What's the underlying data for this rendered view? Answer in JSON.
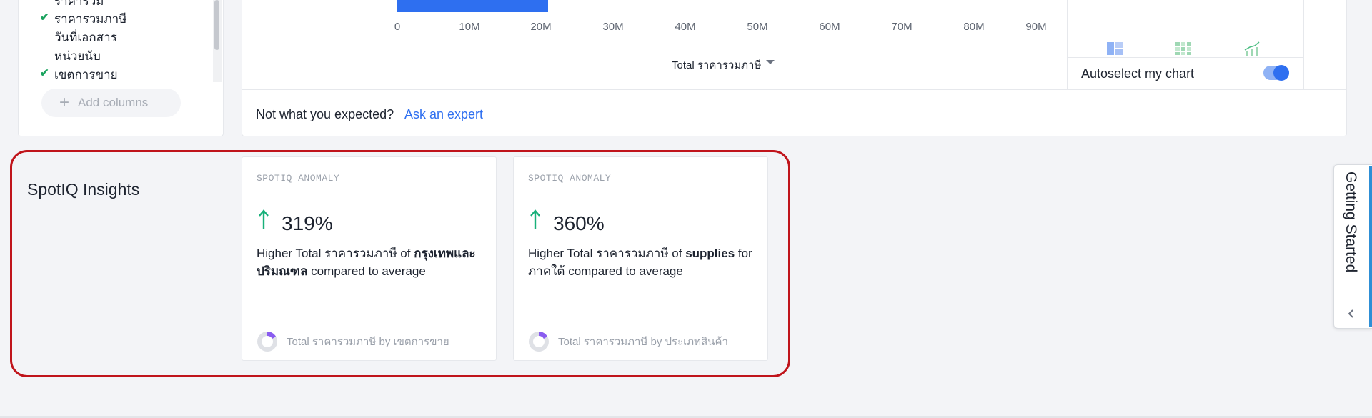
{
  "columns_panel": {
    "items": [
      {
        "label": "ราคารวม",
        "checked": false
      },
      {
        "label": "ราคารวมภาษี",
        "checked": true
      },
      {
        "label": "วันที่เอกสาร",
        "checked": false
      },
      {
        "label": "หน่วยนับ",
        "checked": false
      },
      {
        "label": "เขตการขาย",
        "checked": true
      }
    ],
    "add_columns_label": "Add columns"
  },
  "chart": {
    "axis_ticks": [
      "0",
      "10M",
      "20M",
      "30M",
      "40M",
      "50M",
      "60M",
      "70M",
      "80M",
      "90M"
    ],
    "axis_label": "Total ราคารวมภาษี",
    "autoselect_label": "Autoselect my chart",
    "autoselect_on": true,
    "accent_color": "#2e6ff0"
  },
  "feedback": {
    "prompt": "Not what you expected?",
    "link": "Ask an expert"
  },
  "spotiq": {
    "title": "SpotIQ Insights",
    "cards": [
      {
        "tag": "SPOTIQ ANOMALY",
        "percent": "319%",
        "desc_prefix": "Higher Total ราคารวมภาษี of ",
        "desc_bold": "กรุงเทพและปริมณฑล",
        "desc_suffix": " compared to average",
        "footer": "Total ราคารวมภาษี by เขตการขาย"
      },
      {
        "tag": "SPOTIQ ANOMALY",
        "percent": "360%",
        "desc_prefix": "Higher Total ราคารวมภาษี of ",
        "desc_bold": "supplies",
        "desc_suffix": " for ภาคใต้ compared to average",
        "footer": "Total ราคารวมภาษี by ประเภทสินค้า"
      }
    ]
  },
  "getting_started": {
    "label": "Getting Started"
  },
  "colors": {
    "highlight_outline": "#c0141b",
    "up_arrow": "#19b07a"
  }
}
